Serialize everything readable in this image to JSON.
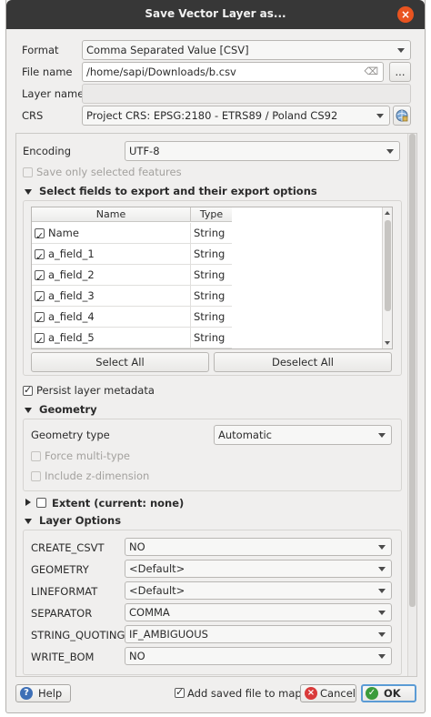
{
  "window": {
    "title": "Save Vector Layer as..."
  },
  "top": {
    "format_label": "Format",
    "format_value": "Comma Separated Value [CSV]",
    "filename_label": "File name",
    "filename_value": "/home/sapi/Downloads/b.csv",
    "browse_label": "...",
    "layername_label": "Layer name",
    "layername_value": "",
    "crs_label": "CRS",
    "crs_value": "Project CRS: EPSG:2180 - ETRS89 / Poland CS92"
  },
  "encoding": {
    "label": "Encoding",
    "value": "UTF-8",
    "save_selected_label": "Save only selected features"
  },
  "fields": {
    "section_title": "Select fields to export and their export options",
    "columns": [
      "Name",
      "Type"
    ],
    "rows": [
      {
        "name": "Name",
        "type": "String",
        "checked": true
      },
      {
        "name": "a_field_1",
        "type": "String",
        "checked": true
      },
      {
        "name": "a_field_2",
        "type": "String",
        "checked": true
      },
      {
        "name": "a_field_3",
        "type": "String",
        "checked": true
      },
      {
        "name": "a_field_4",
        "type": "String",
        "checked": true
      },
      {
        "name": "a_field_5",
        "type": "String",
        "checked": true
      }
    ],
    "select_all_label": "Select All",
    "deselect_all_label": "Deselect All"
  },
  "persist_metadata_label": "Persist layer metadata",
  "geometry": {
    "section_title": "Geometry",
    "type_label": "Geometry type",
    "type_value": "Automatic",
    "force_multi_label": "Force multi-type",
    "include_z_label": "Include z-dimension"
  },
  "extent": {
    "section_title": "Extent (current: none)"
  },
  "layer_options": {
    "section_title": "Layer Options",
    "options": [
      {
        "label": "CREATE_CSVT",
        "value": "NO"
      },
      {
        "label": "GEOMETRY",
        "value": "<Default>"
      },
      {
        "label": "LINEFORMAT",
        "value": "<Default>"
      },
      {
        "label": "SEPARATOR",
        "value": "COMMA"
      },
      {
        "label": "STRING_QUOTING",
        "value": "IF_AMBIGUOUS"
      },
      {
        "label": "WRITE_BOM",
        "value": "NO"
      }
    ]
  },
  "footer": {
    "help_label": "Help",
    "add_to_map_label": "Add saved file to map",
    "cancel_label": "Cancel",
    "ok_label": "OK"
  },
  "colors": {
    "titlebar": "#373737",
    "close": "#e95420",
    "help": "#3d6fb6",
    "cancel": "#d93a3a",
    "ok": "#3b9b3b"
  }
}
